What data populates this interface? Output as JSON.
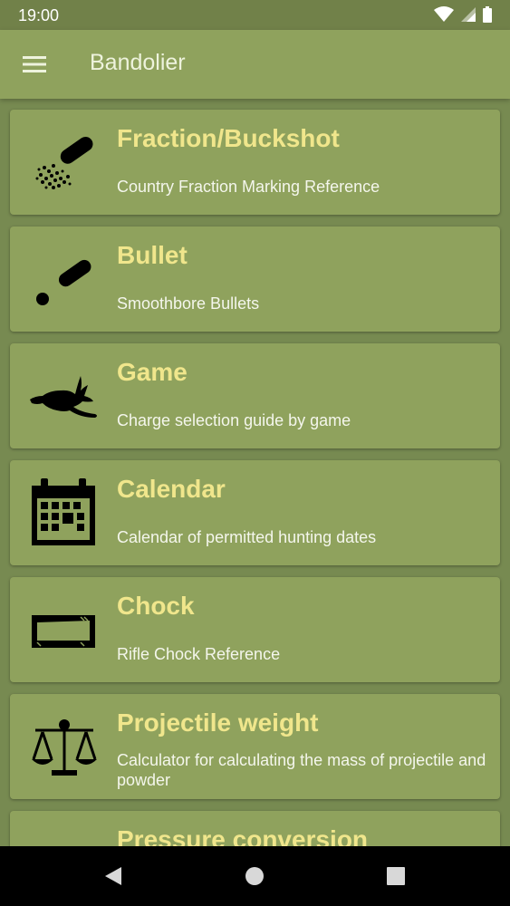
{
  "status_bar": {
    "time": "19:00"
  },
  "app_bar": {
    "title": "Bandolier"
  },
  "items": [
    {
      "title": "Fraction/Buckshot",
      "subtitle": "Country Fraction Marking Reference"
    },
    {
      "title": "Bullet",
      "subtitle": "Smoothbore Bullets"
    },
    {
      "title": "Game",
      "subtitle": "Charge selection guide by game"
    },
    {
      "title": "Calendar",
      "subtitle": "Calendar of permitted hunting dates"
    },
    {
      "title": "Chock",
      "subtitle": "Rifle Chock Reference"
    },
    {
      "title": "Projectile weight",
      "subtitle": "Calculator for calculating the mass of projectile and powder"
    },
    {
      "title": "Pressure conversion",
      "subtitle": ""
    }
  ],
  "colors": {
    "title": "#f0e68c",
    "card": "#8fa25d",
    "background": "#778a51",
    "status_bar": "#718149"
  }
}
